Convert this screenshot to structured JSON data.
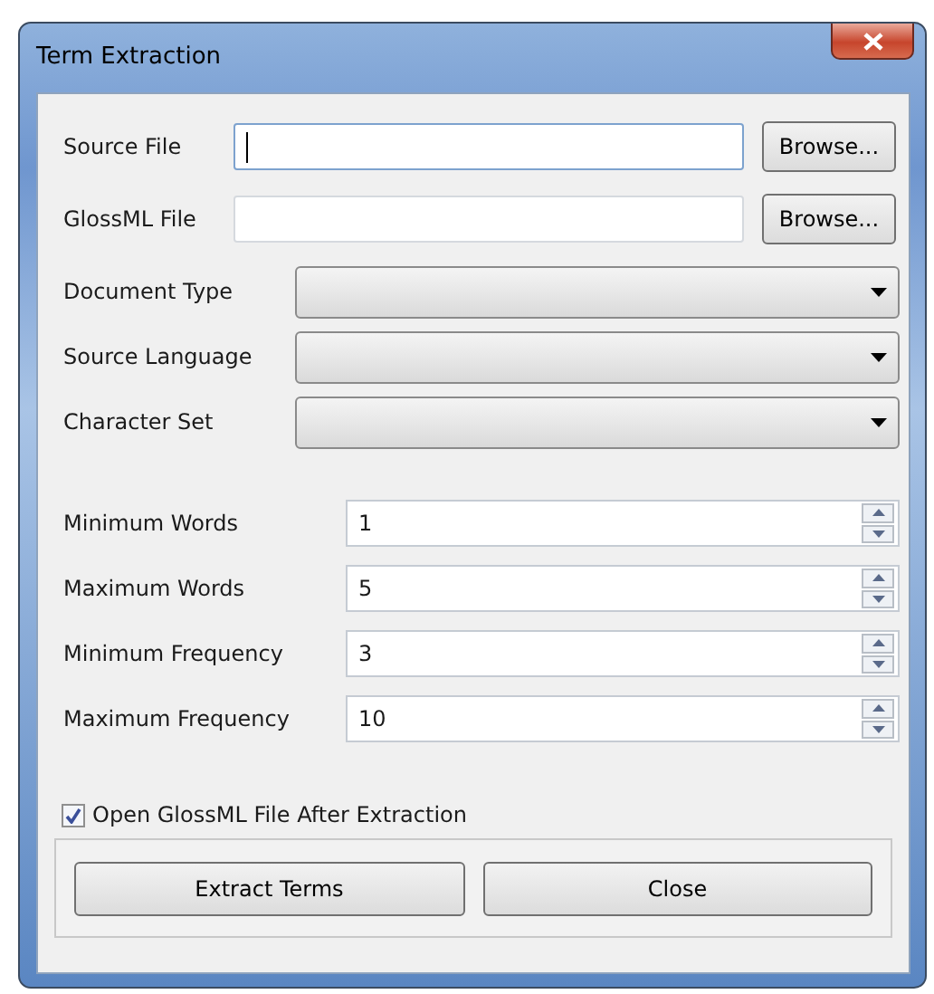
{
  "window": {
    "title": "Term Extraction"
  },
  "file_rows": [
    {
      "label": "Source File",
      "value": "",
      "focused": true,
      "button": "Browse..."
    },
    {
      "label": "GlossML File",
      "value": "",
      "focused": false,
      "button": "Browse..."
    }
  ],
  "dropdowns": [
    {
      "label": "Document Type"
    },
    {
      "label": "Source Language"
    },
    {
      "label": "Character Set"
    }
  ],
  "spinners": [
    {
      "label": "Minimum Words",
      "value": "1"
    },
    {
      "label": "Maximum Words",
      "value": "5"
    },
    {
      "label": "Minimum Frequency",
      "value": "3"
    },
    {
      "label": "Maximum Frequency",
      "value": "10"
    }
  ],
  "option": {
    "label": "Open GlossML File After Extraction",
    "checked": true
  },
  "buttons": [
    "Extract Terms",
    "Close"
  ]
}
